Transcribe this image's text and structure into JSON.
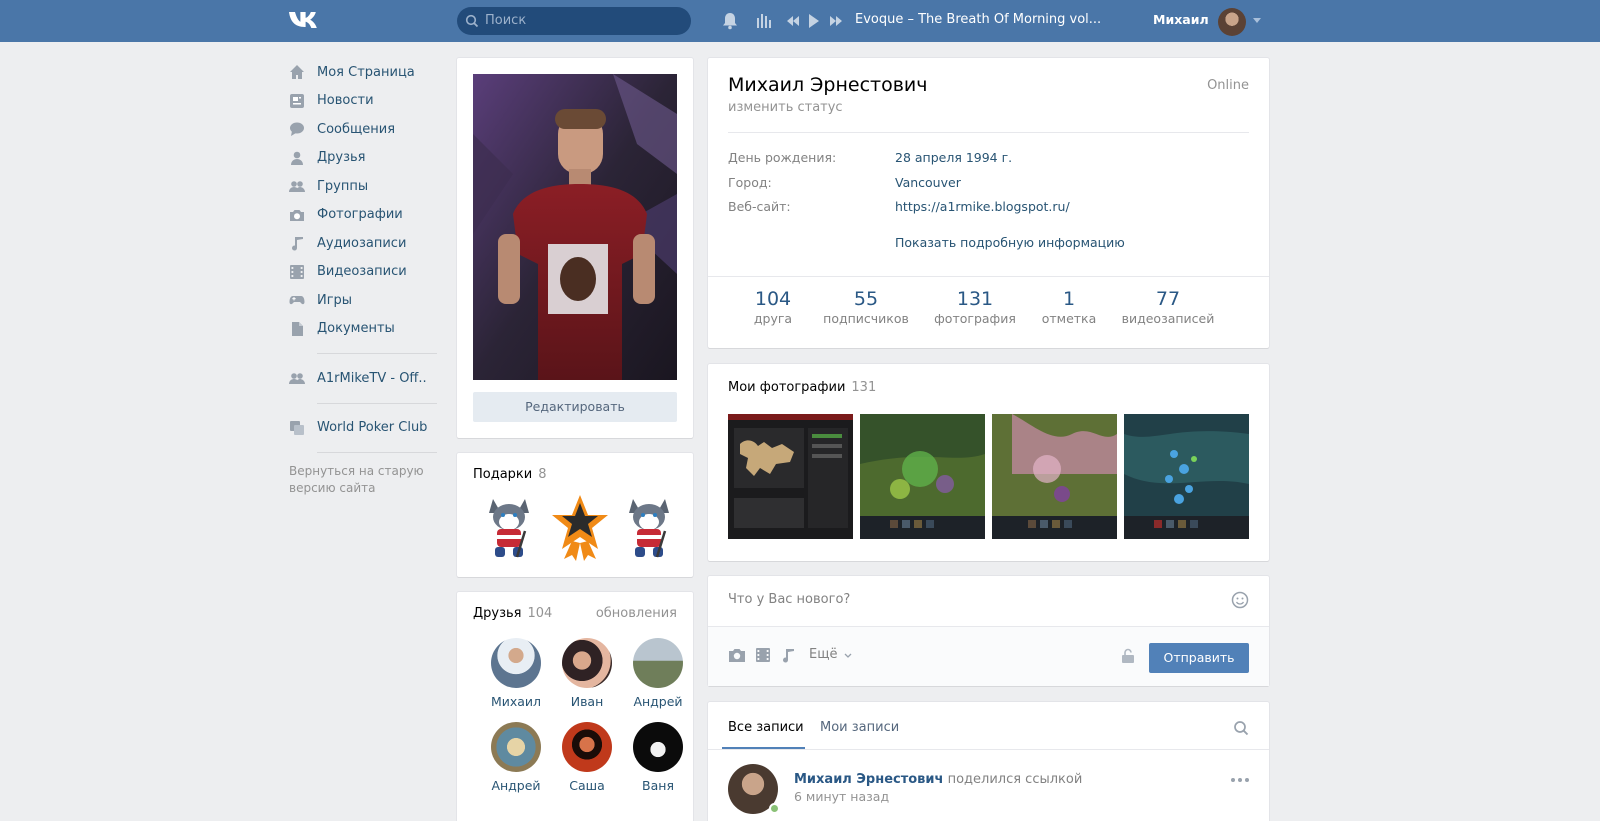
{
  "header": {
    "search_placeholder": "Поиск",
    "track": "Evoque – The Breath Of Morning vol...",
    "user_name": "Михаил"
  },
  "sidebar": {
    "items": [
      {
        "label": "Моя Страница",
        "icon": "home-icon"
      },
      {
        "label": "Новости",
        "icon": "news-icon"
      },
      {
        "label": "Сообщения",
        "icon": "messages-icon"
      },
      {
        "label": "Друзья",
        "icon": "friends-icon"
      },
      {
        "label": "Группы",
        "icon": "groups-icon"
      },
      {
        "label": "Фотографии",
        "icon": "camera-icon"
      },
      {
        "label": "Аудиозаписи",
        "icon": "music-icon"
      },
      {
        "label": "Видеозаписи",
        "icon": "video-icon"
      },
      {
        "label": "Игры",
        "icon": "gamepad-icon"
      },
      {
        "label": "Документы",
        "icon": "document-icon"
      }
    ],
    "group": "A1rMikeTV - Off..",
    "app": "World Poker Club",
    "old_version": "Вернуться на старую версию сайта"
  },
  "profile_card": {
    "edit_label": "Редактировать"
  },
  "gifts": {
    "title": "Подарки",
    "count": "8"
  },
  "friends": {
    "title": "Друзья",
    "count": "104",
    "updates": "обновления",
    "list": [
      "Михаил",
      "Иван",
      "Андрей",
      "Андрей",
      "Саша",
      "Ваня"
    ]
  },
  "profile": {
    "name": "Михаил Эрнестович",
    "status": "изменить статус",
    "online": "Online",
    "info": [
      {
        "label": "День рождения:",
        "value": "28 апреля 1994 г."
      },
      {
        "label": "Город:",
        "value": "Vancouver"
      },
      {
        "label": "Веб-сайт:",
        "value": "https://a1rmike.blogspot.ru/"
      }
    ],
    "more": "Показать подробную информацию",
    "stats": [
      {
        "n": "104",
        "t": "друга"
      },
      {
        "n": "55",
        "t": "подписчиков"
      },
      {
        "n": "131",
        "t": "фотография"
      },
      {
        "n": "1",
        "t": "отметка"
      },
      {
        "n": "77",
        "t": "видеозаписей"
      }
    ]
  },
  "photos": {
    "title": "Мои фотографии",
    "count": "131"
  },
  "composer": {
    "placeholder": "Что у Вас нового?",
    "more": "Ещё",
    "send": "Отправить"
  },
  "wall": {
    "tab_all": "Все записи",
    "tab_mine": "Мои записи",
    "post_author": "Михаил Эрнестович",
    "post_action": "поделился ссылкой",
    "post_time": "6 минут назад"
  },
  "colors": {
    "brand": "#4a76a8",
    "link": "#2a5885",
    "button": "#5181b8"
  }
}
